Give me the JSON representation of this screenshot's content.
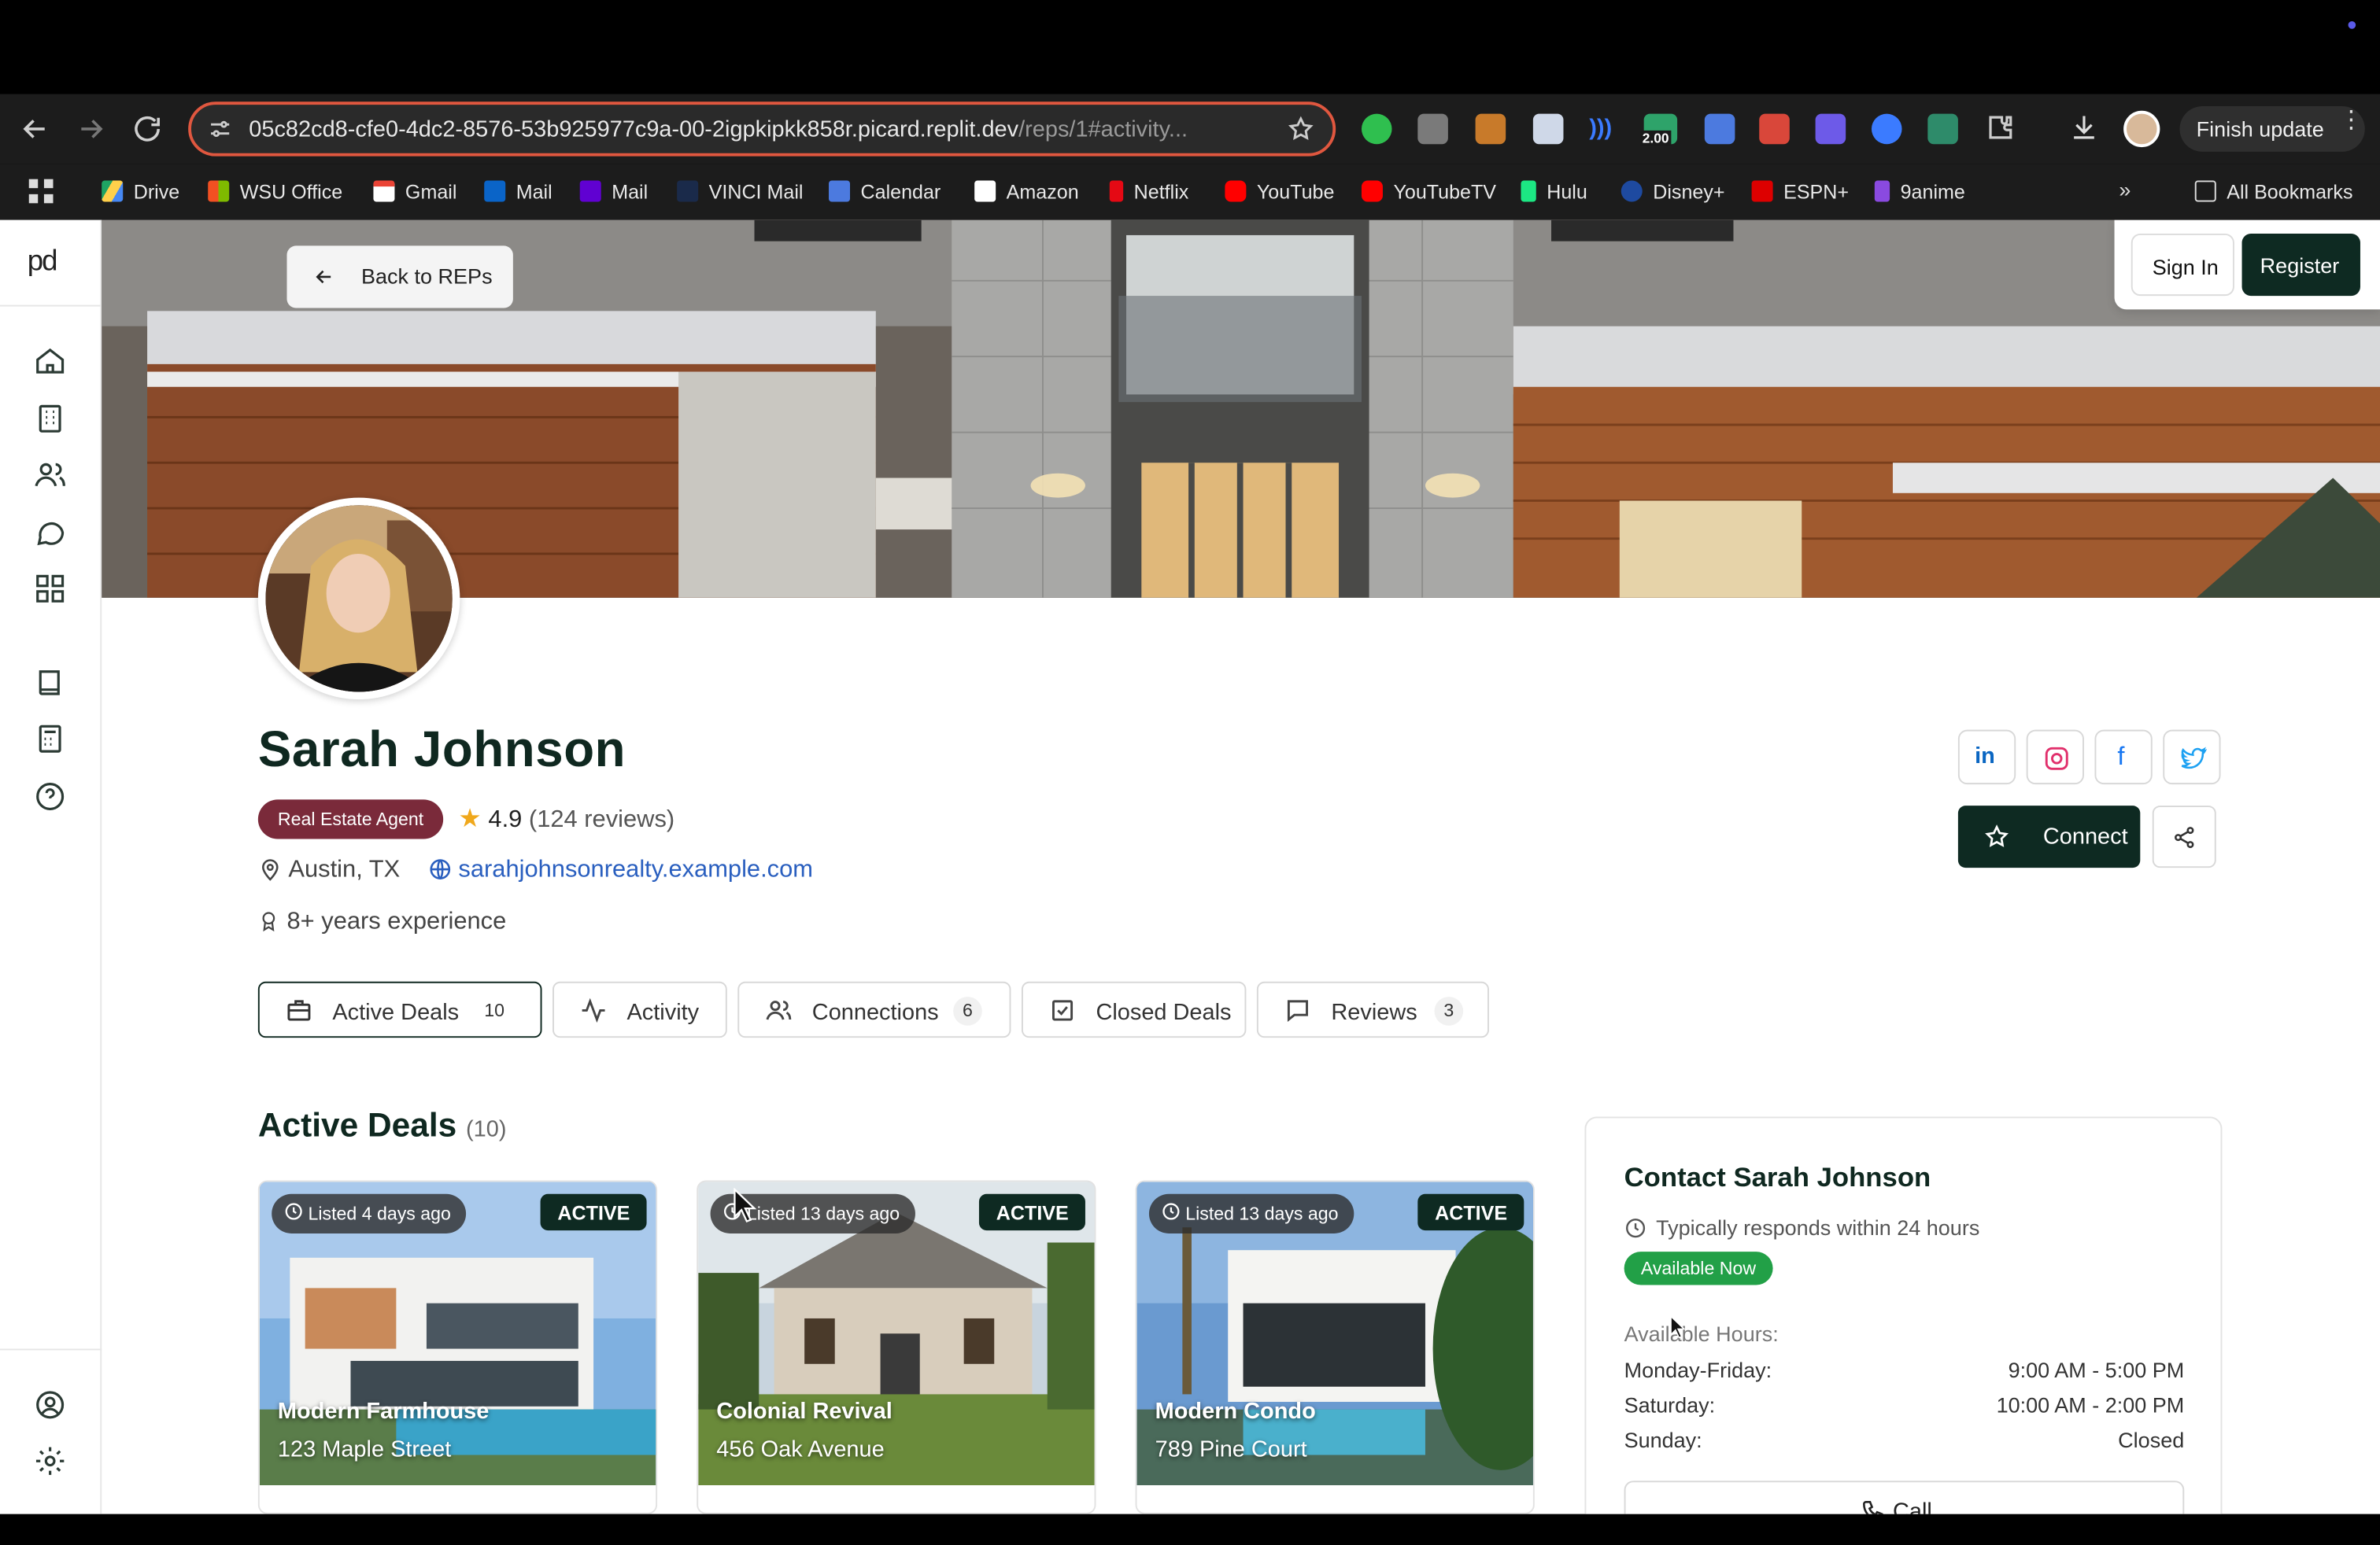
{
  "browser": {
    "url_host": "05c82cd8-cfe0-4dc2-8576-53b925977c9a-00-2igpkipkk858r.picard.replit.dev",
    "url_path": "/reps/1#activity...",
    "finish_update_label": "Finish update",
    "extension_badge": "2.00",
    "bookmarks": [
      "Drive",
      "WSU Office",
      "Gmail",
      "Mail",
      "Mail",
      "VINCI Mail",
      "Calendar",
      "Amazon",
      "Netflix",
      "YouTube",
      "YouTubeTV",
      "Hulu",
      "Disney+",
      "ESPN+",
      "9anime"
    ],
    "all_bookmarks_label": "All Bookmarks"
  },
  "app": {
    "logo_text": "pd",
    "back_label": "Back to REPs",
    "sign_in_label": "Sign In",
    "register_label": "Register"
  },
  "profile": {
    "name": "Sarah Johnson",
    "role_badge": "Real Estate Agent",
    "rating": "4.9",
    "reviews_text": "(124 reviews)",
    "location": "Austin, TX",
    "website": "sarahjohnsonrealty.example.com",
    "experience": "8+ years experience",
    "connect_label": "Connect"
  },
  "tabs": [
    {
      "label": "Active Deals",
      "count": "10"
    },
    {
      "label": "Activity",
      "count": ""
    },
    {
      "label": "Connections",
      "count": "6"
    },
    {
      "label": "Closed Deals",
      "count": ""
    },
    {
      "label": "Reviews",
      "count": "3"
    }
  ],
  "deals": {
    "heading": "Active Deals",
    "count_text": "(10)",
    "status_label": "ACTIVE",
    "items": [
      {
        "listed": "Listed 4 days ago",
        "title": "Modern Farmhouse",
        "address": "123 Maple Street"
      },
      {
        "listed": "Listed 13 days ago",
        "title": "Colonial Revival",
        "address": "456 Oak Avenue"
      },
      {
        "listed": "Listed 13 days ago",
        "title": "Modern Condo",
        "address": "789 Pine Court"
      }
    ]
  },
  "contact": {
    "title": "Contact Sarah Johnson",
    "response": "Typically responds within 24 hours",
    "availability": "Available Now",
    "hours_label": "Available Hours:",
    "hours": [
      {
        "day": "Monday-Friday:",
        "time": "9:00 AM - 5:00 PM"
      },
      {
        "day": "Saturday:",
        "time": "10:00 AM - 2:00 PM"
      },
      {
        "day": "Sunday:",
        "time": "Closed"
      }
    ],
    "call_label": "Call"
  },
  "colors": {
    "brand_dark": "#0e2a22",
    "badge": "#7a2a3a",
    "available": "#22a047",
    "link": "#2a5fbf",
    "star": "#f0a81c"
  }
}
